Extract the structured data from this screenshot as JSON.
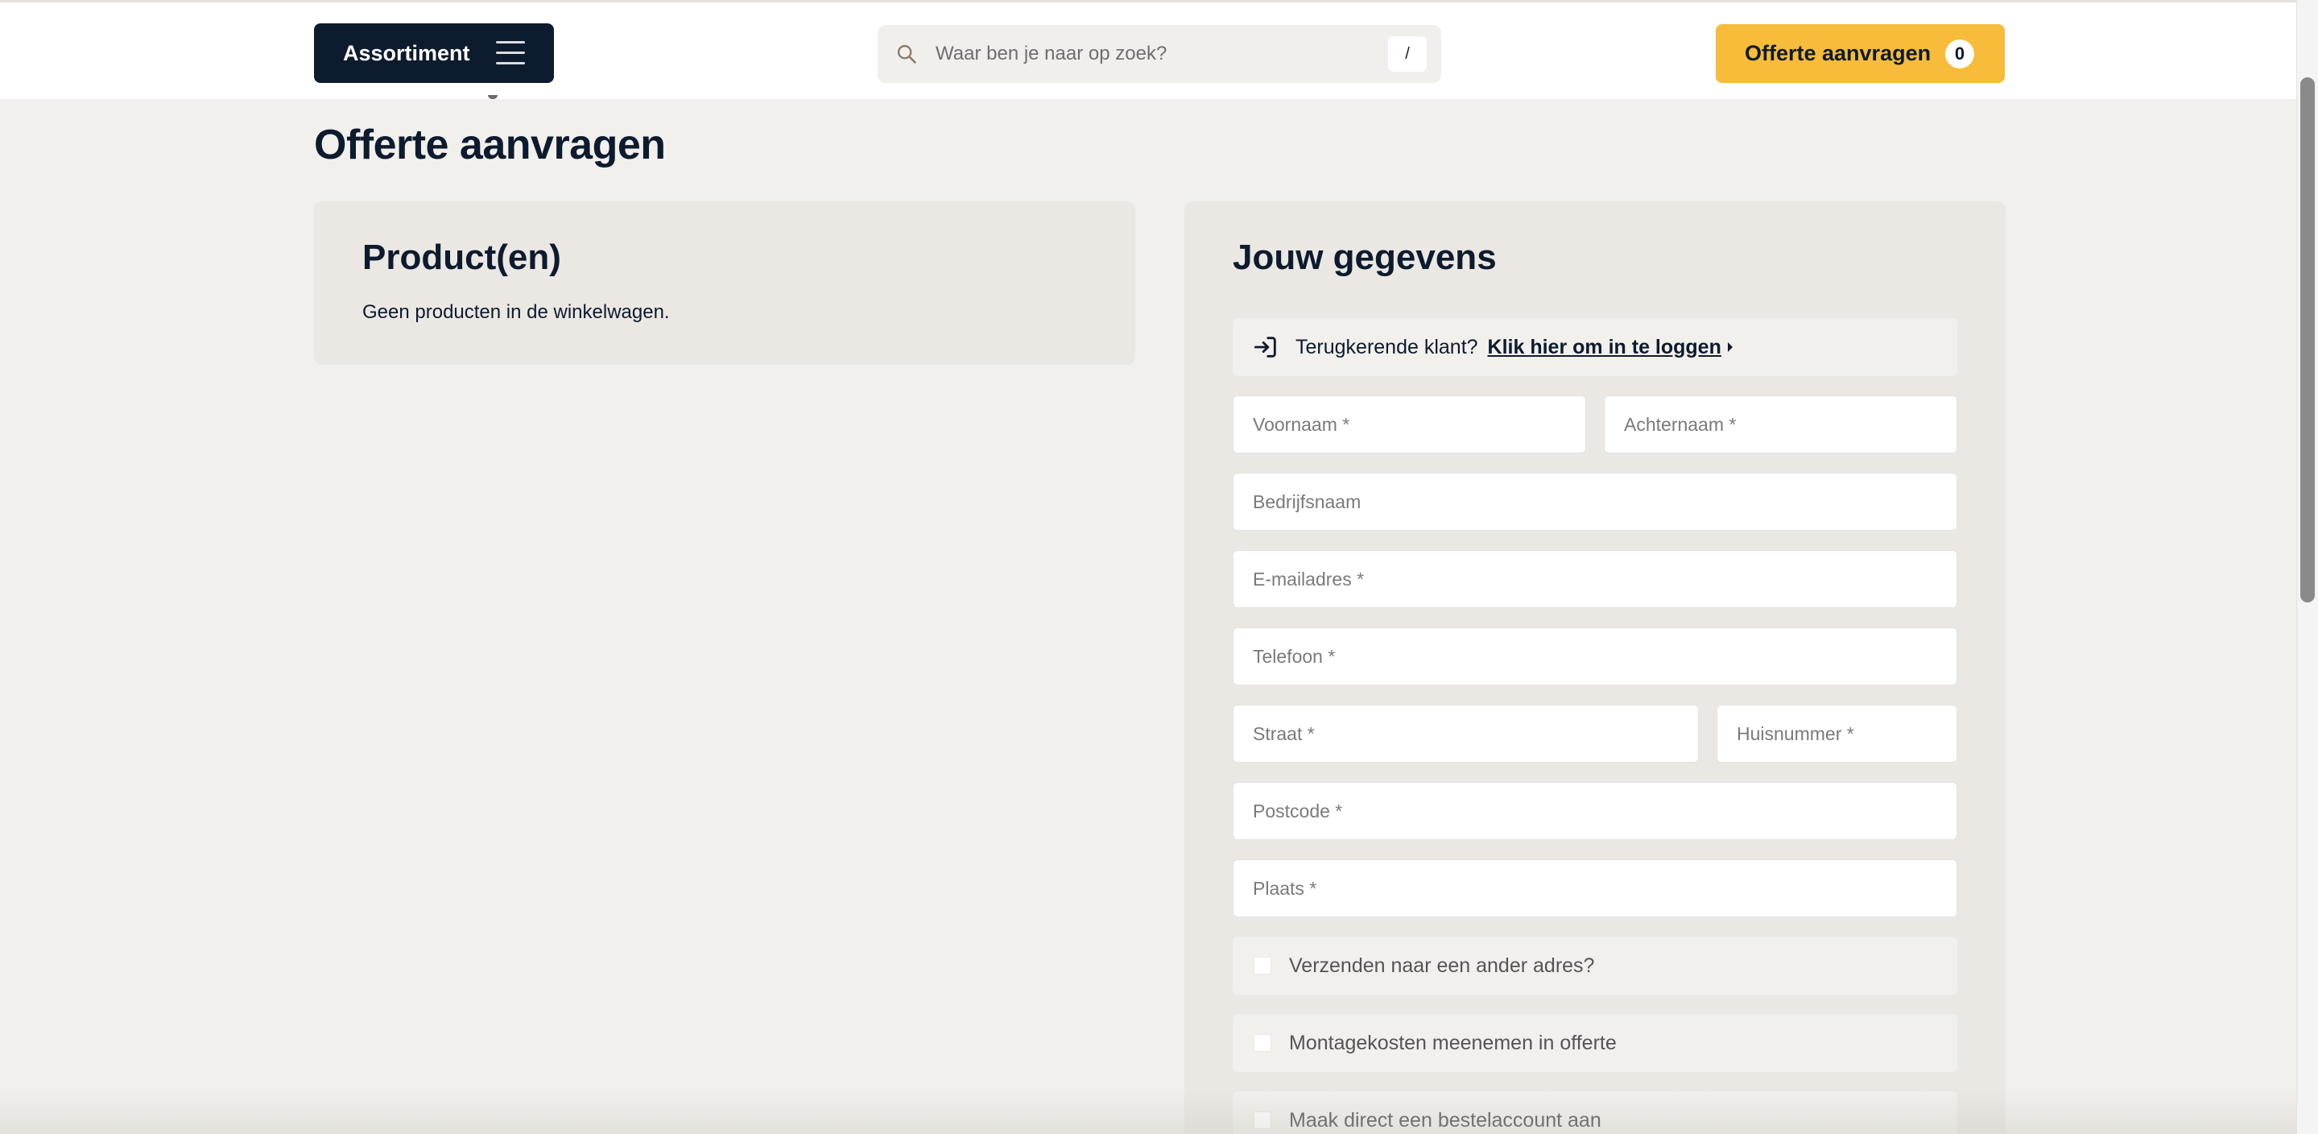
{
  "header": {
    "assortiment_label": "Assortiment",
    "search_placeholder": "Waar ben je naar op zoek?",
    "search_shortcut": "/",
    "offerte_label": "Offerte aanvragen",
    "offerte_count": "0"
  },
  "main": {
    "title": "Offerte aanvragen"
  },
  "products": {
    "title": "Product(en)",
    "empty_text": "Geen producten in de winkelwagen."
  },
  "details": {
    "title": "Jouw gegevens",
    "login_prompt": "Terugkerende klant?",
    "login_link": "Klik hier om in te loggen",
    "fields": {
      "voornaam": "Voornaam *",
      "achternaam": "Achternaam *",
      "bedrijfsnaam": "Bedrijfsnaam",
      "email": "E-mailadres *",
      "telefoon": "Telefoon *",
      "straat": "Straat *",
      "huisnummer": "Huisnummer *",
      "postcode": "Postcode *",
      "plaats": "Plaats *"
    },
    "checkboxes": [
      {
        "label": "Verzenden naar een ander adres?",
        "checked": false
      },
      {
        "label": "Montagekosten meenemen in offerte",
        "checked": false
      },
      {
        "label": "Maak direct een bestelaccount aan",
        "checked": false
      }
    ]
  },
  "colors": {
    "navy": "#0d1b2e",
    "accent_yellow": "#f6bc3a",
    "page_bg": "#f2f0ec",
    "card_bg": "#ebe7e3"
  },
  "icons": {
    "menu": "hamburger-icon",
    "search": "search-icon",
    "login": "login-icon"
  }
}
